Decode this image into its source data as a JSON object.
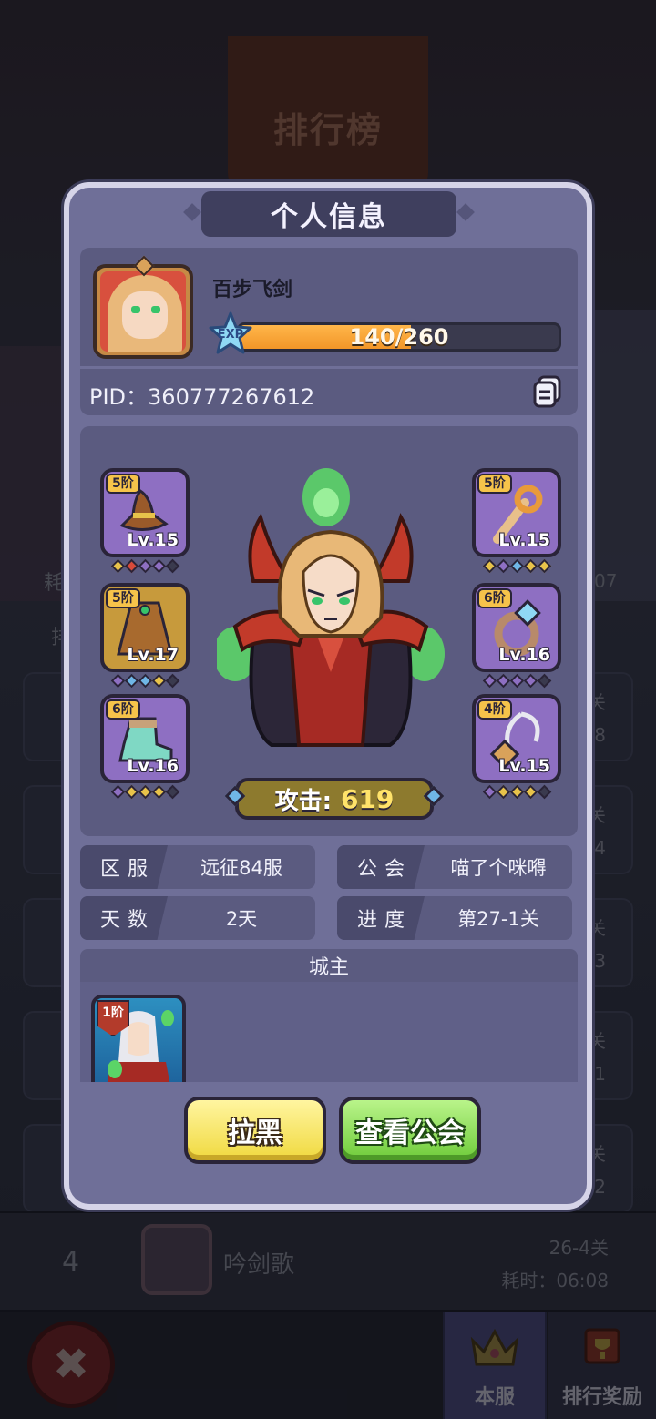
{
  "background": {
    "title": "排行榜",
    "rows_right": [
      {
        "stage": "关",
        "time": "08"
      },
      {
        "stage": "关",
        "time": "04"
      },
      {
        "stage": "关",
        "time": "23"
      },
      {
        "stage": "关",
        "time": "01"
      },
      {
        "stage": "关",
        "time": "02"
      }
    ],
    "left_fragment": "耗",
    "left_fragment2": "排",
    "right_fragment": "07",
    "row4": {
      "rank": "4",
      "name": "吟剑歌",
      "stage": "26-4关",
      "time": "耗时：06:08"
    },
    "tabs": [
      {
        "label": "本服",
        "icon": "crown-icon"
      },
      {
        "label": "排行奖励",
        "icon": "trophy-banner-icon"
      }
    ],
    "close_icon": "close-icon"
  },
  "modal": {
    "title": "个人信息",
    "player": {
      "name": "百步飞剑",
      "exp_label": "EXP",
      "exp_current": 140,
      "exp_max": 260,
      "exp_text": "140/260",
      "pid": "PID：360777267612"
    },
    "equipment": {
      "left": [
        {
          "grade": "5阶",
          "level": "Lv.15",
          "item": "hat",
          "rarity": "purple",
          "gems": [
            "#e8c34a",
            "#d84a3a",
            "#8e6fc2",
            "#8e6fc2",
            "#3a3a4e"
          ]
        },
        {
          "grade": "5阶",
          "level": "Lv.17",
          "item": "cloak",
          "rarity": "gold",
          "gems": [
            "#8e6fc2",
            "#6fb6e6",
            "#6fb6e6",
            "#e8c34a",
            "#3a3a4e"
          ]
        },
        {
          "grade": "6阶",
          "level": "Lv.16",
          "item": "boot",
          "rarity": "purple",
          "gems": [
            "#8e6fc2",
            "#e8c34a",
            "#e8c34a",
            "#e8c34a",
            "#3a3a4e"
          ]
        }
      ],
      "right": [
        {
          "grade": "5阶",
          "level": "Lv.15",
          "item": "staff",
          "rarity": "purple",
          "gems": [
            "#e8c34a",
            "#8e6fc2",
            "#6fb6e6",
            "#e8c34a",
            "#e8c34a"
          ]
        },
        {
          "grade": "6阶",
          "level": "Lv.16",
          "item": "ring",
          "rarity": "purple",
          "gems": [
            "#8e6fc2",
            "#8e6fc2",
            "#8e6fc2",
            "#8e6fc2",
            "#3a3a4e"
          ]
        },
        {
          "grade": "4阶",
          "level": "Lv.15",
          "item": "amulet",
          "rarity": "purple",
          "gems": [
            "#8e6fc2",
            "#e8c34a",
            "#e8c34a",
            "#e8c34a",
            "#3a3a4e"
          ]
        }
      ]
    },
    "power": {
      "label": "攻击:",
      "value": "619"
    },
    "info": [
      {
        "key": "区服",
        "value": "远征84服"
      },
      {
        "key": "公会",
        "value": "喵了个咪嘚"
      },
      {
        "key": "天数",
        "value": "2天"
      },
      {
        "key": "进度",
        "value": "第27-1关"
      }
    ],
    "lord": {
      "header": "城主",
      "grade": "1阶"
    },
    "buttons": {
      "block": "拉黑",
      "view_guild": "查看公会"
    }
  }
}
